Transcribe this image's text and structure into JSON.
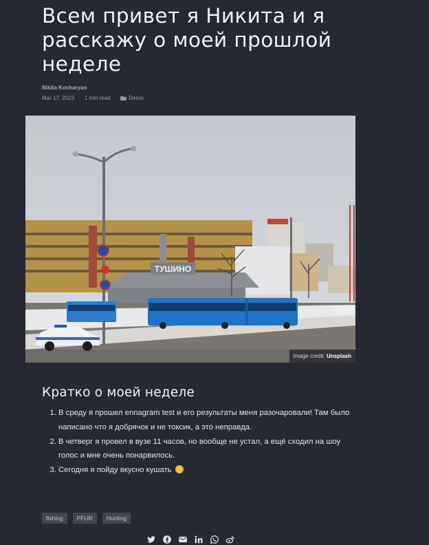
{
  "post": {
    "title": "Всем привет я Никита и я расскажу о моей прошлой неделе",
    "author": "Nikita Kocharyan",
    "date": "Mar 17, 2023",
    "read_time": "1 min read",
    "category": "Demo"
  },
  "hero_image": {
    "credit_prefix": "Image credit:",
    "credit_source": "Unsplash",
    "sign_text": "ТУШИНО"
  },
  "section": {
    "title": "Кратко о моей неделе",
    "items": [
      "В среду я прошел ennagram test и его результаты меня разочаровали! Там было написано что я добрячок и не токсик, а это неправда.",
      "В четверг я провел в вузе 11 часов, но вообще не устал, а ещё сходил на шоу голос и мне очень понарвилось.",
      "Сегодня я пойду вкусно кушать"
    ]
  },
  "tags": [
    "fishing",
    "PFUR",
    "Hunting"
  ],
  "share_icons": [
    "twitter-icon",
    "facebook-icon",
    "email-icon",
    "linkedin-icon",
    "whatsapp-icon",
    "weibo-icon"
  ],
  "colors": {
    "background": "#262833",
    "tag_bg": "#43454f",
    "bus": "#1f74c9"
  }
}
